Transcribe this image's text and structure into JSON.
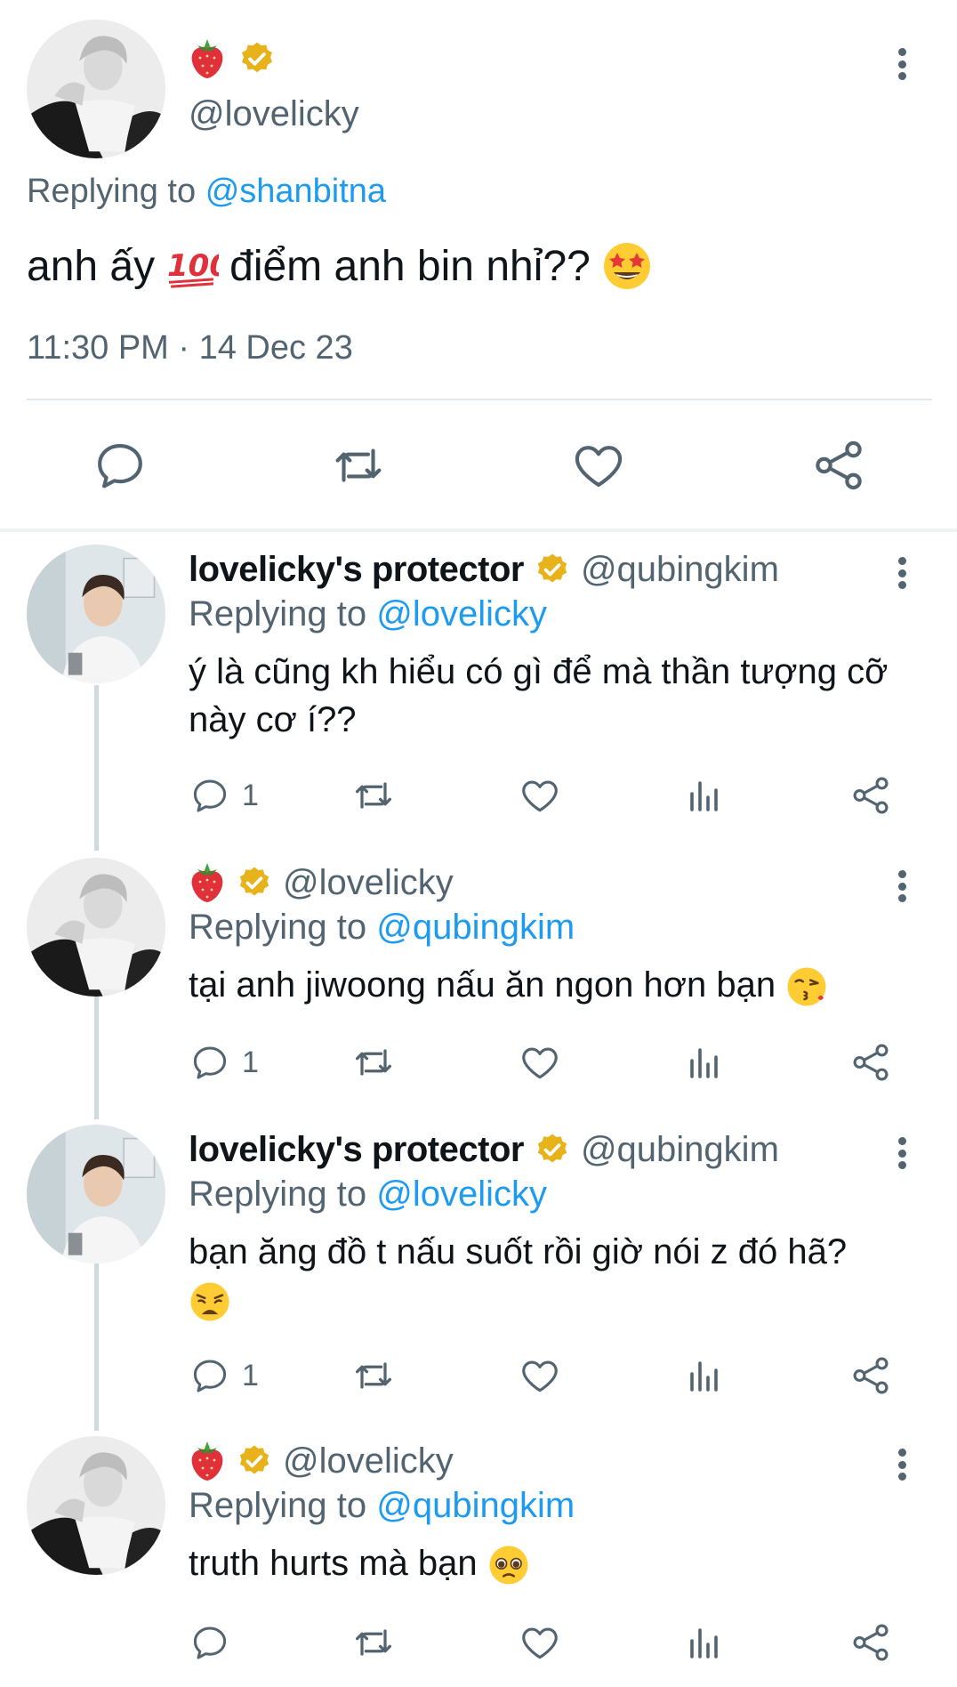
{
  "main_tweet": {
    "handle": "@lovelicky",
    "name_icons": [
      "strawberry-icon",
      "verified-badge-icon"
    ],
    "replying_prefix": "Replying to",
    "replying_to": "@shanbitna",
    "text_part1": "anh ấy",
    "text_emoji1": "hundred-points-emoji",
    "text_part2": "điểm anh bin nhỉ??",
    "text_emoji2": "star-struck-emoji",
    "timestamp": "11:30 PM · 14 Dec 23",
    "actions": [
      "reply-icon",
      "retweet-icon",
      "like-icon",
      "share-icon"
    ]
  },
  "replies": [
    {
      "name": "lovelicky's protector",
      "verified": true,
      "handle": "@qubingkim",
      "replying_prefix": "Replying to",
      "replying_to": "@lovelicky",
      "text": "ý là cũng kh hiểu có gì để mà thần tượng cỡ này cơ í??",
      "reply_count": "1"
    },
    {
      "name_icons": [
        "strawberry-icon",
        "verified-badge-icon"
      ],
      "handle": "@lovelicky",
      "replying_prefix": "Replying to",
      "replying_to": "@qubingkim",
      "text": "tại anh jiwoong nấu ăn ngon hơn bạn",
      "text_emoji": "kissing-face-emoji",
      "reply_count": "1"
    },
    {
      "name": "lovelicky's protector",
      "verified": true,
      "handle": "@qubingkim",
      "replying_prefix": "Replying to",
      "replying_to": "@lovelicky",
      "text": "bạn ăng đồ t nấu suốt rồi giờ nói z đó hã?",
      "text_emoji": "weary-face-emoji",
      "reply_count": "1"
    },
    {
      "name_icons": [
        "strawberry-icon",
        "verified-badge-icon"
      ],
      "handle": "@lovelicky",
      "replying_prefix": "Replying to",
      "replying_to": "@qubingkim",
      "text": "truth hurts mà bạn",
      "text_emoji": "pleading-face-emoji",
      "reply_count": ""
    }
  ],
  "colors": {
    "text": "#0f1419",
    "secondary": "#536471",
    "link": "#1d9bf0",
    "verified_gold": "#e8b21a",
    "divider": "#e1e6ea",
    "thread_line": "#cfd9de"
  }
}
